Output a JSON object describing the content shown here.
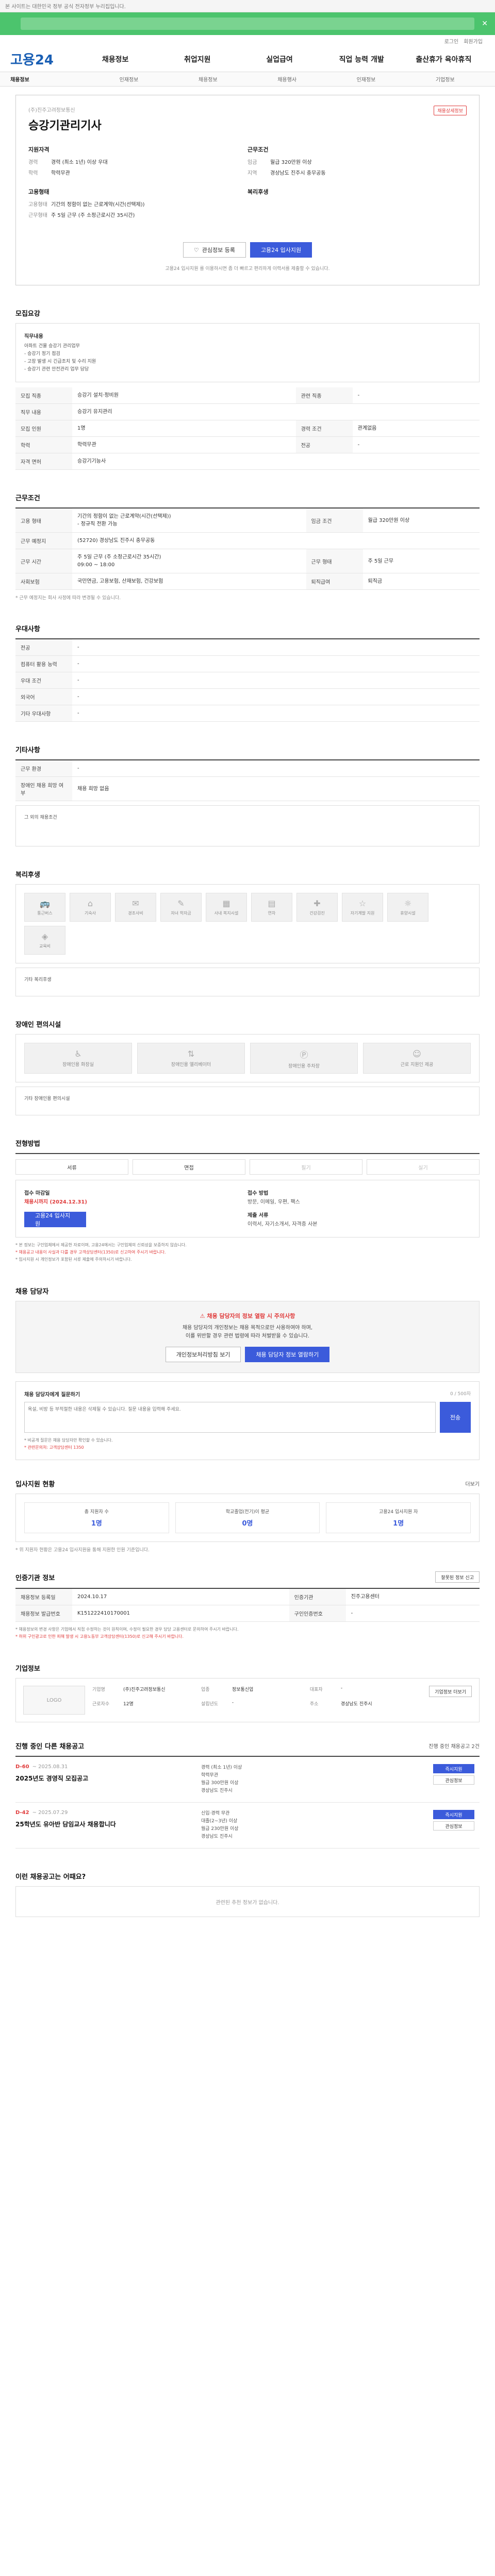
{
  "topbar": {
    "text": "본 사이트는 대한민국 정부 공식 전자정부 누리집입니다."
  },
  "util": {
    "login": "로그인",
    "join": "회원가입"
  },
  "brand": {
    "logo": "고용24"
  },
  "gnb": [
    "채용정보",
    "취업지원",
    "실업급여",
    "직업 능력 개발",
    "출산휴가 육아휴직"
  ],
  "subnav": [
    "채용정보",
    "인재정보",
    "채용정보",
    "채용행사",
    "인재정보",
    "기업정보"
  ],
  "job": {
    "company": "(주)진주고려정보통신",
    "title": "승강기관리기사",
    "badge": "채용상세정보",
    "qual_head": "지원자격",
    "work_head": "근무조건",
    "qual_rows": [
      {
        "k": "경력",
        "v": "경력 (최소 1년) 이상 우대"
      },
      {
        "k": "학력",
        "v": "학력무관"
      }
    ],
    "work_rows": [
      {
        "k": "임금",
        "v": "월급 320만원 이상"
      },
      {
        "k": "지역",
        "v": "경상남도 진주시 충무공동"
      }
    ],
    "emp_head": "고용형태",
    "welfare_head": "복리후생",
    "emp_rows": [
      {
        "k": "고용형태",
        "v": "기간의 정함이 없는 근로계약(시간(선택제))"
      },
      {
        "k": "근무형태",
        "v": "주 5일 근무 (주 소정근로시간 35시간)"
      }
    ],
    "scrap_btn": "관심정보 등록",
    "apply_btn": "고용24 입사지원",
    "notice": "고용24 입사지원 를 이용하시면 좀 더 빠르고 편리하게 이력서를 제출할 수 있습니다."
  },
  "recruit": {
    "title": "모집요강",
    "box_h": "직무내용",
    "box_p": "아파트 건물 승강기 관리업무\n- 승강기 정기 점검\n- 고장 발생 시 긴급조치 및 수리 지원\n- 승강기 관련 안전관리 업무 담당",
    "rows": [
      {
        "k": "모집 직종",
        "v": "승강기 설치·정비원",
        "k2": "관련 직종",
        "v2": "-"
      },
      {
        "k": "직무 내용",
        "v": "승강기 유지관리"
      },
      {
        "k": "모집 인원",
        "v": "1명",
        "k2": "경력 조건",
        "v2": "관계없음"
      },
      {
        "k": "학력",
        "v": "학력무관",
        "k2": "전공",
        "v2": "-"
      },
      {
        "k": "자격 면허",
        "v": "승강기기능사"
      }
    ]
  },
  "work": {
    "title": "근무조건",
    "rows": [
      {
        "k": "고용 형태",
        "v": "기간의 정함이 없는 근로계약(시간(선택제))\n- 정규직 전환 가능",
        "k2": "임금 조건",
        "v2": "월급 320만원 이상"
      },
      {
        "k": "근무 예정지",
        "v": "(52720) 경상남도 진주시 충무공동"
      },
      {
        "k": "근무 시간",
        "v": "주 5일 근무 (주 소정근로시간 35시간)\n09:00 ~ 18:00",
        "k2": "근무 형태",
        "v2": "주 5일 근무"
      },
      {
        "k": "사회보험",
        "v": "국민연금, 고용보험, 산재보험, 건강보험",
        "k2": "퇴직급여",
        "v2": "퇴직금"
      }
    ],
    "footnote": "* 근무 예정지는 회사 사정에 따라 변경될 수 있습니다."
  },
  "prefs": {
    "title": "우대사항",
    "rows": [
      {
        "k": "전공",
        "v": "-"
      },
      {
        "k": "컴퓨터 활용 능력",
        "v": "-"
      },
      {
        "k": "우대 조건",
        "v": "-"
      },
      {
        "k": "외국어",
        "v": "-"
      },
      {
        "k": "기타 우대사항",
        "v": "-"
      }
    ]
  },
  "other": {
    "title": "기타사항",
    "rows": [
      {
        "k": "근무 환경",
        "v": "-"
      },
      {
        "k": "장애인 채용 희망 여부",
        "v": "채용 희망 없음"
      }
    ],
    "extra_label": "그 외의 채용조건"
  },
  "welfare": {
    "title": "복리후생",
    "items": [
      "통근버스",
      "기숙사",
      "경조사비",
      "자녀 학자금",
      "사내 복지시설",
      "연차",
      "건강검진",
      "자기계발 지원",
      "휴양시설",
      "교육비"
    ],
    "extra_label": "기타 복리후생"
  },
  "disability": {
    "title": "장애인 편의시설",
    "items": [
      "장애인용 화장실",
      "장애인용 엘리베이터",
      "장애인용 주차장",
      "근로 지원인 제공"
    ],
    "extra_label": "기타 장애인용 편의시설"
  },
  "process": {
    "title": "전형방법",
    "steps": [
      "서류",
      "면접",
      "필기",
      "실기"
    ],
    "deadline_label": "접수 마감일",
    "deadline_val": "채용시까지 (2024.12.31)",
    "method_label": "접수 방법",
    "method_val": "방문, 이메일, 우편, 팩스",
    "apply_btn": "고용24 입사지원",
    "docs_label": "제출 서류",
    "docs_val": "이력서, 자기소개서, 자격증 사본",
    "warns": [
      "* 본 정보는 구인업체에서 제공한 자료이며, 고용24에서는 구인업체의 신뢰성을 보증하지 않습니다.",
      "* 채용공고 내용이 사실과 다를 경우 고객상담센터(1350)로 신고하여 주시기 바랍니다.",
      "* 입사지원 시 개인정보가 포함된 서류 제출에 주의하시기 바랍니다."
    ]
  },
  "contact": {
    "title": "채용 담당자",
    "alert_title": "채용 담당자의 정보 열람 시 주의사항",
    "alert_p": "채용 담당자의 개인정보는 채용 목적으로만 사용하여야 하며,\n이를 위반할 경우 관련 법령에 따라 처벌받을 수 있습니다.",
    "btn1": "개인정보처리방침 보기",
    "btn2": "채용 담당자 정보 열람하기",
    "qa_label": "채용 담당자에게 질문하기",
    "qa_count": "0 / 500자",
    "qa_placeholder": "욕설, 비방 등 부적절한 내용은 삭제될 수 있습니다. 질문 내용을 입력해 주세요.",
    "send": "전송",
    "qa_notes": [
      "* 비공개 질문은 채용 담당자만 확인할 수 있습니다.",
      "* 관련문의처: 고객상담센터 1350"
    ]
  },
  "stats": {
    "title": "입사지원 현황",
    "more": "더보기",
    "items": [
      {
        "label": "총 지원자 수",
        "num": "1명"
      },
      {
        "label": "학교졸업(전기)이 평균",
        "num": "0명"
      },
      {
        "label": "고용24 입사지원 자",
        "num": "1명"
      }
    ],
    "note": "* 위 지원자 현황은 고용24 입사지원을 통해 지원한 인원 기준입니다."
  },
  "info": {
    "title": "인증기관 정보",
    "report_btn": "잘못된 정보 신고",
    "rows": [
      {
        "k": "채용정보 등록일",
        "v": "2024.10.17",
        "k2": "인증기관",
        "v2": "진주고용센터"
      },
      {
        "k": "채용정보 발급번호",
        "v": "K151222410170001",
        "k2": "구인인증번호",
        "v2": "-"
      }
    ],
    "notes": [
      "* 채용정보의 변경 사항은 기업에서 직접 수정하는 것이 원칙이며, 수정이 필요한 경우 담당 고용센터로 문의하여 주시기 바랍니다.",
      "* 허위 구인광고로 인한 피해 발생 시 고용노동부 고객상담센터(1350)로 신고해 주시기 바랍니다."
    ]
  },
  "company": {
    "title": "기업정보",
    "logo_alt": "LOGO",
    "btn": "기업정보 더보기",
    "rows": [
      {
        "k": "기업명",
        "v": "(주)진주고려정보통신"
      },
      {
        "k": "업종",
        "v": "정보통신업"
      },
      {
        "k": "대표자",
        "v": "-"
      },
      {
        "k": "근로자수",
        "v": "12명"
      },
      {
        "k": "설립년도",
        "v": "-"
      },
      {
        "k": "주소",
        "v": "경상남도 진주시"
      }
    ]
  },
  "related": {
    "title": "진행 중인 다른 채용공고",
    "count": "진행 중인 채용공고 2건",
    "items": [
      {
        "dday": "D-60",
        "date": "~ 2025.08.31",
        "title": "2025년도 경영직 모집공고",
        "info": "경력 (최소 1년) 이상\n학력무관\n월급 300만원 이상\n경상남도 진주시",
        "b1": "즉시지원",
        "b2": "관심정보"
      },
      {
        "dday": "D-42",
        "date": "~ 2025.07.29",
        "title": "25학년도 유아반 담임교사 채용합니다",
        "info": "신입·경력 무관\n대졸(2~3년) 이상\n월급 230만원 이상\n경상남도 진주시",
        "b1": "즉시지원",
        "b2": "관심정보"
      }
    ]
  },
  "recommend": {
    "title": "이런 채용공고는 어때요?",
    "empty": "관련된 추천 정보가 없습니다."
  }
}
